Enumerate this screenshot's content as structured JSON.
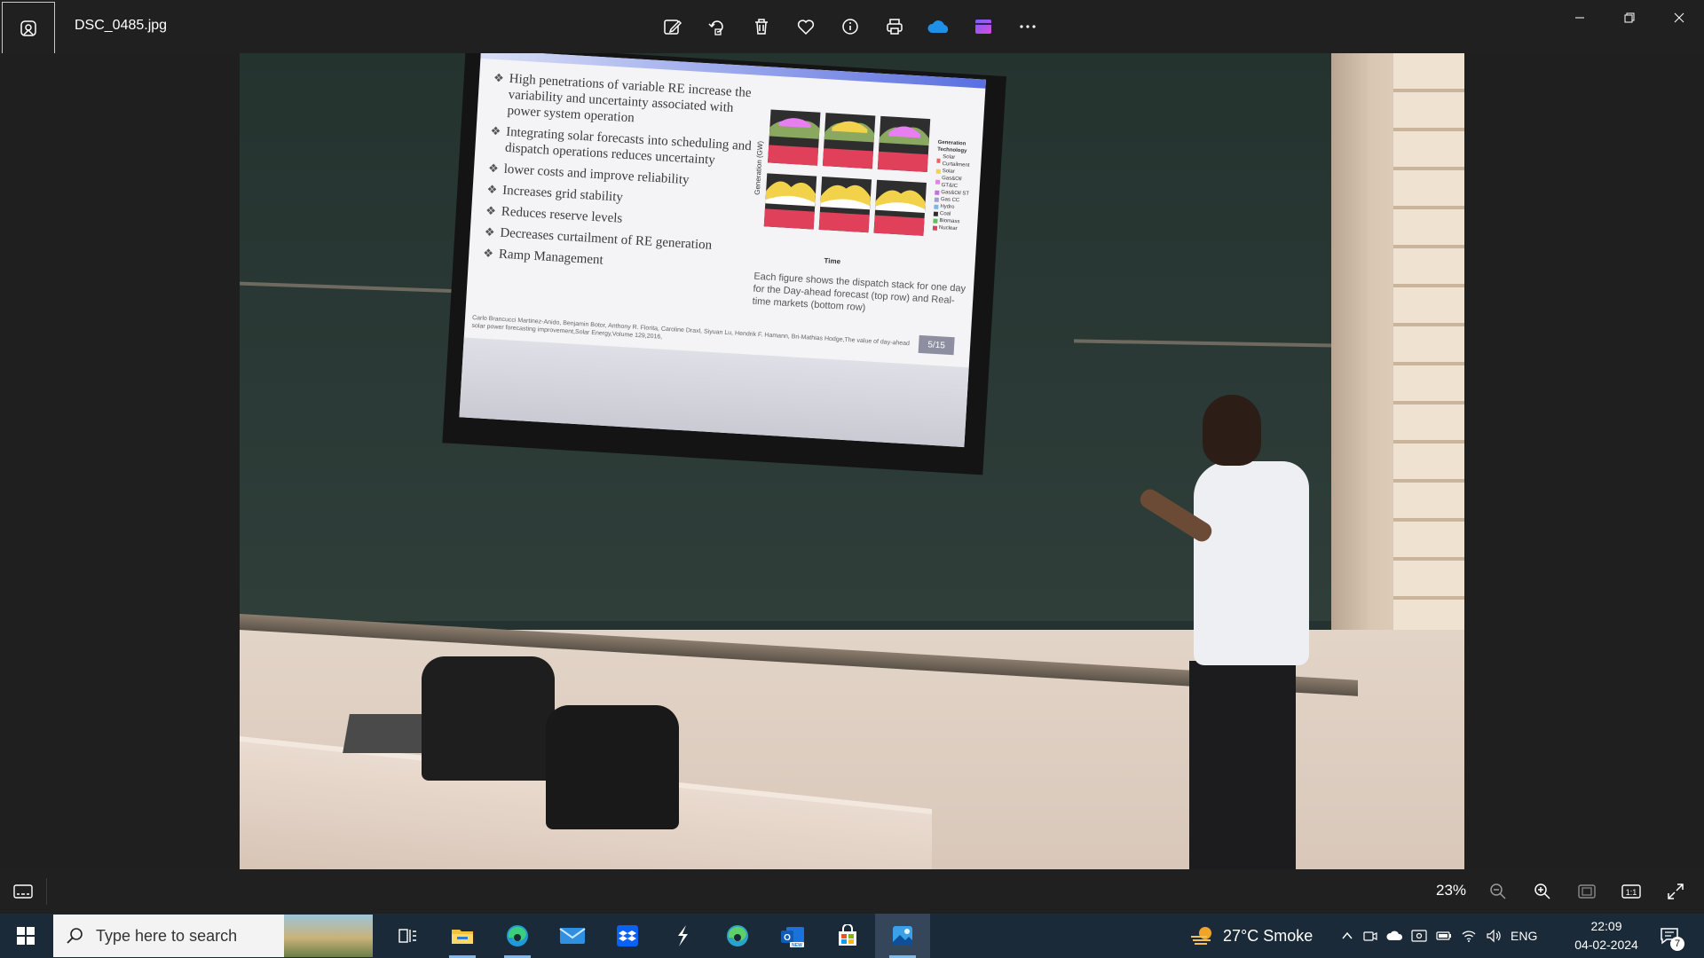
{
  "window": {
    "file_name": "DSC_0485.jpg",
    "toolbar": [
      {
        "name": "edit-image-icon"
      },
      {
        "name": "rotate-icon"
      },
      {
        "name": "delete-icon"
      },
      {
        "name": "favorite-icon"
      },
      {
        "name": "info-icon"
      },
      {
        "name": "print-icon"
      },
      {
        "name": "onedrive-icon"
      },
      {
        "name": "clipchamp-icon"
      },
      {
        "name": "more-icon"
      }
    ]
  },
  "slide": {
    "bullets": [
      "High penetrations of variable RE increase the variability and uncertainty associated with power system operation",
      "Integrating solar forecasts into scheduling and dispatch operations reduces uncertainty",
      "lower costs and improve reliability",
      "Increases grid stability",
      "Reduces reserve levels",
      "Decreases curtailment of RE generation",
      "Ramp Management"
    ],
    "y_axis_label": "Generation (GW)",
    "x_axis_label": "Time",
    "legend_title": "Generation Technology",
    "legend_items": [
      {
        "label": "Solar Curtailment",
        "color": "#f06060"
      },
      {
        "label": "Solar",
        "color": "#f2d24a"
      },
      {
        "label": "Gas&Oil GT&IC",
        "color": "#e87ff0"
      },
      {
        "label": "Gas&Oil ST",
        "color": "#c070e0"
      },
      {
        "label": "Gas CC",
        "color": "#a0a0d0"
      },
      {
        "label": "Hydro",
        "color": "#7fb6e0"
      },
      {
        "label": "Coal",
        "color": "#2e2e2e"
      },
      {
        "label": "Biomass",
        "color": "#5fbf5f"
      },
      {
        "label": "Nuclear",
        "color": "#e0405a"
      }
    ],
    "caption": "Each figure shows the dispatch stack for one day for the Day-ahead forecast (top row) and Real-time markets (bottom row)",
    "citation": "Carlo Brancucci Martinez-Anido, Benjamin Botor, Anthony R. Florita, Caroline Draxl, Siyuan Lu, Hendrik F. Hamann, Bri-Mathias Hodge,The value of day-ahead solar power forecasting improvement,Solar Energy,Volume 129,2016,",
    "slide_number": "5/15"
  },
  "bottombar": {
    "zoom_level": "23%"
  },
  "taskbar": {
    "search_placeholder": "Type here to search",
    "apps": [
      {
        "name": "task-view-icon"
      },
      {
        "name": "file-explorer-icon"
      },
      {
        "name": "edge-icon"
      },
      {
        "name": "mail-icon"
      },
      {
        "name": "dropbox-icon"
      },
      {
        "name": "app-s-icon"
      },
      {
        "name": "edge-beta-icon"
      },
      {
        "name": "outlook-new-icon"
      },
      {
        "name": "microsoft-store-icon"
      },
      {
        "name": "photos-icon"
      }
    ],
    "weather": "27°C Smoke",
    "language": "ENG",
    "time": "22:09",
    "date": "04-02-2024",
    "notification_count": "7"
  }
}
